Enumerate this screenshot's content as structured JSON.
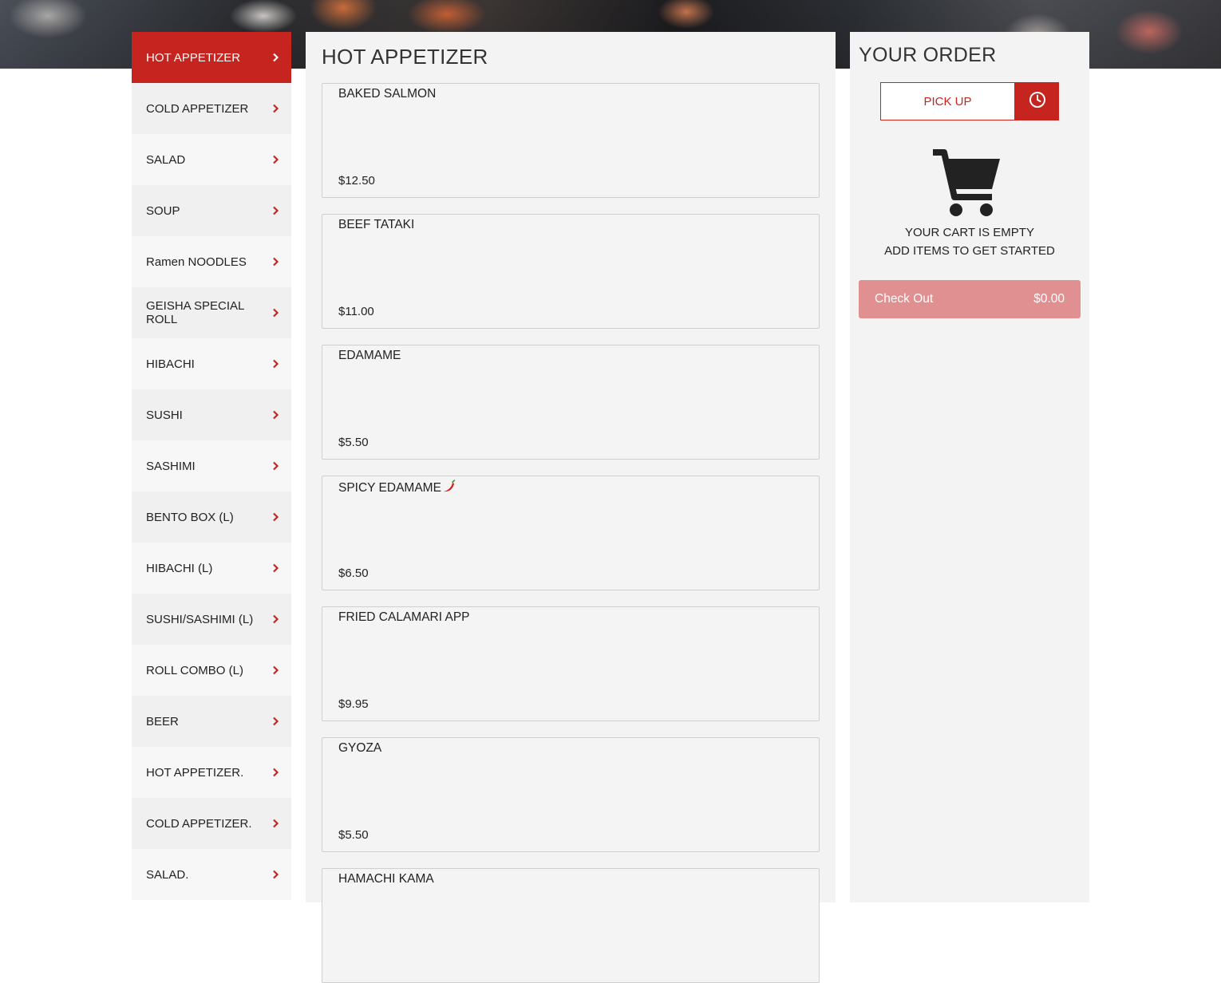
{
  "sidebar": {
    "items": [
      {
        "label": "HOT APPETIZER"
      },
      {
        "label": "COLD APPETIZER"
      },
      {
        "label": "SALAD"
      },
      {
        "label": "SOUP"
      },
      {
        "label": "Ramen NOODLES"
      },
      {
        "label": "GEISHA SPECIAL ROLL"
      },
      {
        "label": "HIBACHI"
      },
      {
        "label": "SUSHI"
      },
      {
        "label": "SASHIMI"
      },
      {
        "label": "BENTO BOX (L)"
      },
      {
        "label": "HIBACHI (L)"
      },
      {
        "label": "SUSHI/SASHIMI (L)"
      },
      {
        "label": "ROLL COMBO (L)"
      },
      {
        "label": "BEER"
      },
      {
        "label": "HOT APPETIZER."
      },
      {
        "label": "COLD APPETIZER."
      },
      {
        "label": "SALAD."
      }
    ],
    "active_index": 0
  },
  "menu": {
    "title": "HOT APPETIZER",
    "items": [
      {
        "name": "BAKED SALMON",
        "price": "$12.50"
      },
      {
        "name": "BEEF TATAKI",
        "price": "$11.00"
      },
      {
        "name": "EDAMAME",
        "price": "$5.50"
      },
      {
        "name": "SPICY EDAMAME",
        "price": "$6.50",
        "icon": "chili-pepper-icon"
      },
      {
        "name": "FRIED CALAMARI APP",
        "price": "$9.95"
      },
      {
        "name": "GYOZA",
        "price": "$5.50"
      },
      {
        "name": "HAMACHI KAMA",
        "price": ""
      }
    ]
  },
  "order": {
    "title": "YOUR ORDER",
    "pickup_label": "PICK UP",
    "schedule_icon": "clock-icon",
    "cart_icon": "cart-icon",
    "empty_line1": "YOUR CART IS EMPTY",
    "empty_line2": "ADD ITEMS TO GET STARTED",
    "checkout_label": "Check Out",
    "checkout_total": "$0.00"
  },
  "colors": {
    "accent": "#c5241f",
    "checkout_disabled": "#e09090",
    "panel": "#f3f3f3"
  }
}
